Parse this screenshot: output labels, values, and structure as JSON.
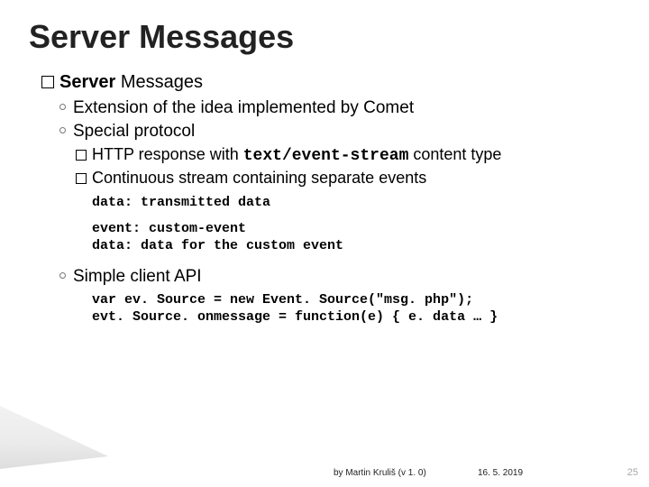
{
  "title": "Server Messages",
  "lvl1_bold": "Server",
  "lvl1_rest": " Messages",
  "bullets": {
    "b1": "Extension of the idea implemented by Comet",
    "b2": "Special protocol",
    "b2a_pre": "HTTP response with ",
    "b2a_code": "text/event-stream",
    "b2a_post": " content type",
    "b2b": "Continuous stream containing separate events",
    "code1": "data: transmitted data",
    "code2": "event: custom-event\ndata: data for the custom event",
    "b3": "Simple client API",
    "code3": "var ev. Source = new Event. Source(\"msg. php\");\nevt. Source. onmessage = function(e) { e. data … }"
  },
  "footer": {
    "credit": "by Martin Kruliš (v 1. 0)",
    "date": "16. 5. 2019",
    "page": "25"
  }
}
